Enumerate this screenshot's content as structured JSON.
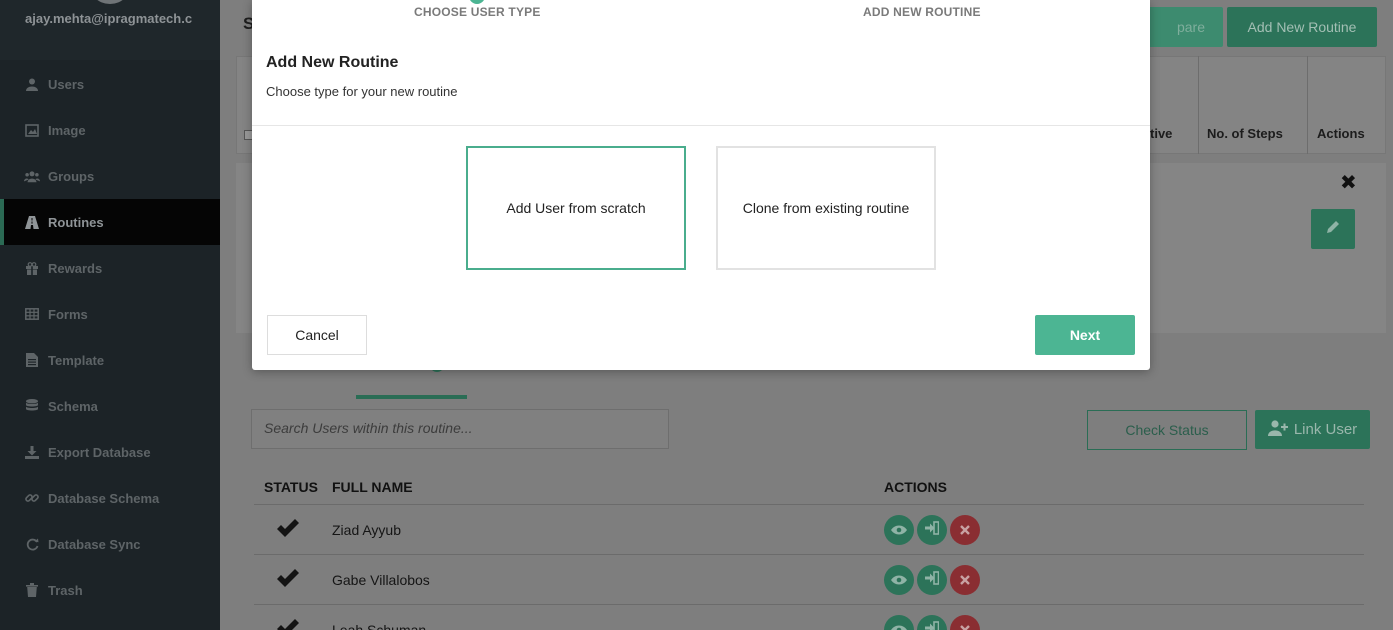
{
  "sidebar": {
    "email": "ajay.mehta@ipragmatech.c",
    "items": [
      {
        "label": "Users",
        "icon": "user-icon"
      },
      {
        "label": "Image",
        "icon": "image-icon"
      },
      {
        "label": "Groups",
        "icon": "groups-icon"
      },
      {
        "label": "Routines",
        "icon": "road-icon",
        "active": true
      },
      {
        "label": "Rewards",
        "icon": "gift-icon"
      },
      {
        "label": "Forms",
        "icon": "table-icon"
      },
      {
        "label": "Template",
        "icon": "file-icon"
      },
      {
        "label": "Schema",
        "icon": "database-icon"
      },
      {
        "label": "Export Database",
        "icon": "download-icon"
      },
      {
        "label": "Database Schema",
        "icon": "link-icon"
      },
      {
        "label": "Database Sync",
        "icon": "refresh-icon"
      },
      {
        "label": "Trash",
        "icon": "trash-icon"
      }
    ]
  },
  "background": {
    "title_partial": "S",
    "compare_partial": "pare",
    "add_routine_label": "Add New Routine",
    "table_headers": {
      "active_partial": "tive",
      "steps": "No. of Steps",
      "actions": "Actions"
    },
    "search_placeholder": "Search Users within this routine...",
    "check_status_label": "Check Status",
    "link_user_label": "Link User",
    "users_headers": {
      "status": "STATUS",
      "full_name": "FULL NAME",
      "actions": "ACTIONS"
    },
    "users": [
      {
        "name": "Ziad Ayyub"
      },
      {
        "name": "Gabe Villalobos"
      },
      {
        "name": "Leah Schuman"
      }
    ]
  },
  "modal": {
    "steps": [
      "CHOOSE USER TYPE",
      "ADD NEW ROUTINE"
    ],
    "title": "Add New Routine",
    "subtitle": "Choose type for your new routine",
    "options": [
      "Add User from scratch",
      "Clone from existing routine"
    ],
    "cancel_label": "Cancel",
    "next_label": "Next"
  },
  "colors": {
    "accent": "#4cb593",
    "sidebar_bg": "#1c2327",
    "danger": "#d9534f"
  }
}
